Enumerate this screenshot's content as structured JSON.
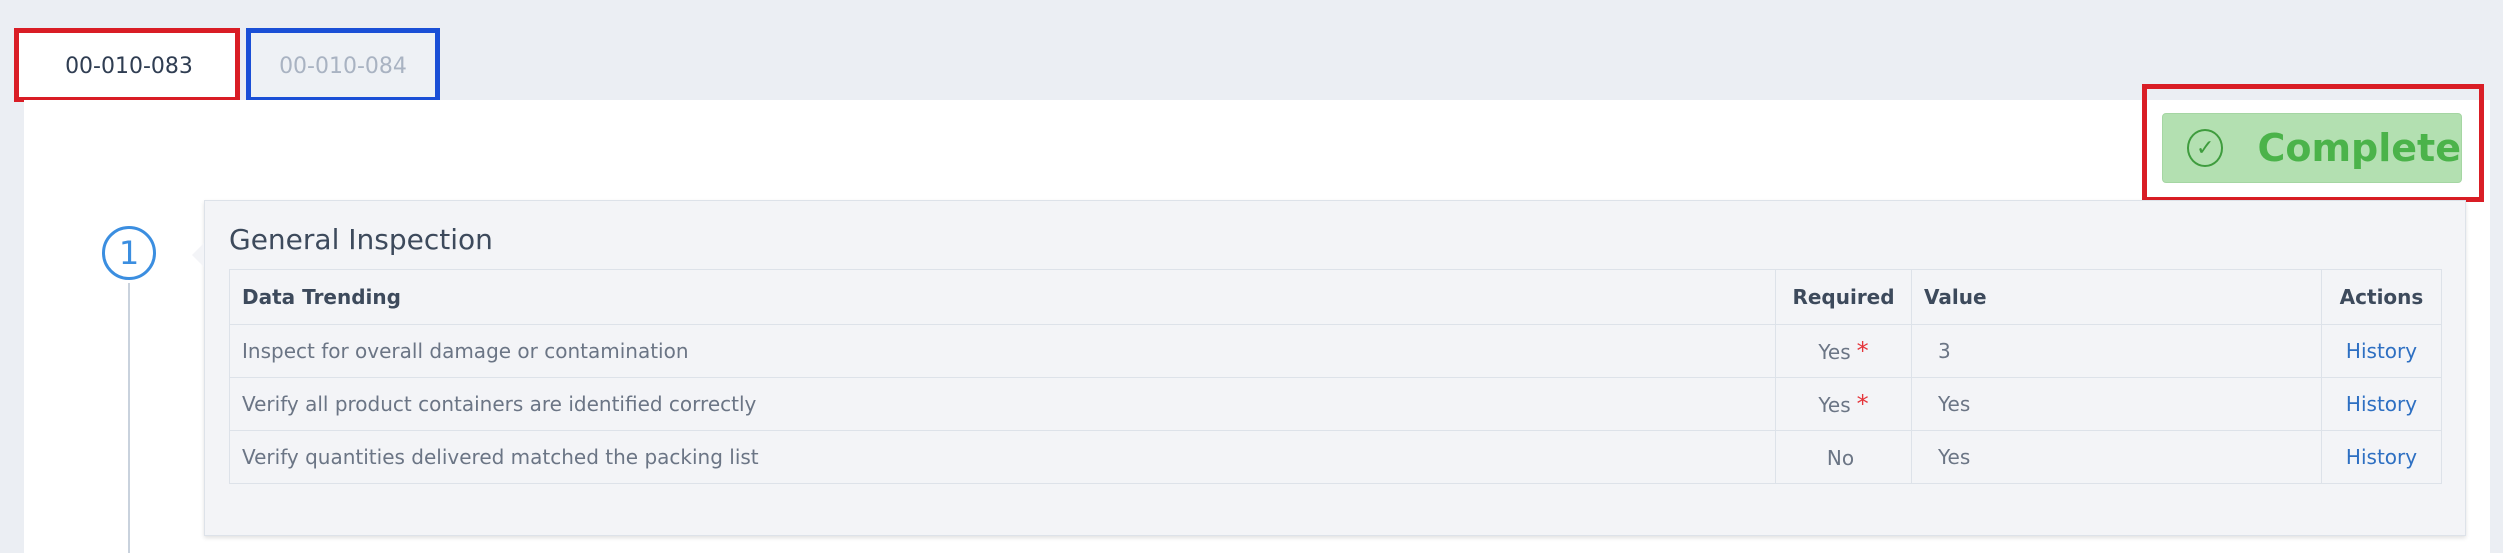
{
  "tabs": [
    {
      "label": "00-010-083",
      "active": true
    },
    {
      "label": "00-010-084",
      "active": false
    }
  ],
  "complete_button": {
    "label": "Complete",
    "icon": "check-circle-icon",
    "color": "#4bb34a"
  },
  "step": {
    "number": "1"
  },
  "section": {
    "title": "General Inspection",
    "columns": [
      "Data Trending",
      "Required",
      "Value",
      "Actions"
    ],
    "rows": [
      {
        "item": "Inspect for overall damage or contamination",
        "required": "Yes",
        "required_flag": "*",
        "value": "3",
        "action": "History"
      },
      {
        "item": "Verify all product containers are identified correctly",
        "required": "Yes",
        "required_flag": "*",
        "value": "Yes",
        "action": "History"
      },
      {
        "item": "Verify quantities delivered matched the packing list",
        "required": "No",
        "required_flag": "",
        "value": "Yes",
        "action": "History"
      }
    ]
  }
}
